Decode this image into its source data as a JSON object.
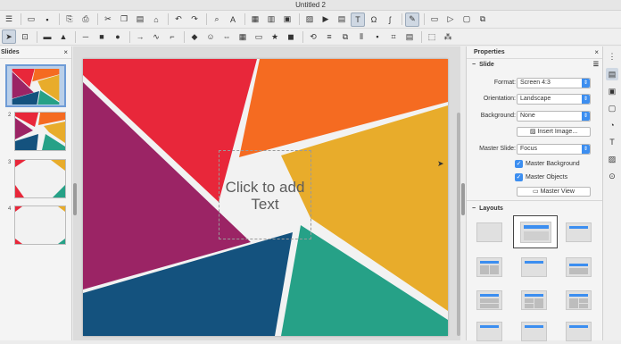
{
  "window": {
    "title": "Untitled 2"
  },
  "slides_pane": {
    "title": "Slides",
    "close": "×",
    "slides": [
      {
        "num": "1"
      },
      {
        "num": "2"
      },
      {
        "num": "3"
      },
      {
        "num": "4"
      }
    ]
  },
  "editor": {
    "placeholder_text": "Click to add Text"
  },
  "properties": {
    "title": "Properties",
    "close": "×",
    "slide_section": {
      "title": "Slide",
      "format_label": "Format:",
      "format_value": "Screen 4:3",
      "orientation_label": "Orientation:",
      "orientation_value": "Landscape",
      "background_label": "Background:",
      "background_value": "None",
      "insert_image": "Insert Image...",
      "master_slide_label": "Master Slide:",
      "master_slide_value": "Focus",
      "master_background": "Master Background",
      "master_objects": "Master Objects",
      "master_view": "Master View"
    },
    "layouts_section": {
      "title": "Layouts"
    }
  },
  "colors": {
    "red": "#e8273a",
    "orange": "#f56b21",
    "yellow": "#e8ac2b",
    "purple": "#9b2465",
    "navy": "#14527e",
    "teal": "#26a187",
    "accent": "#3c8ef0"
  }
}
